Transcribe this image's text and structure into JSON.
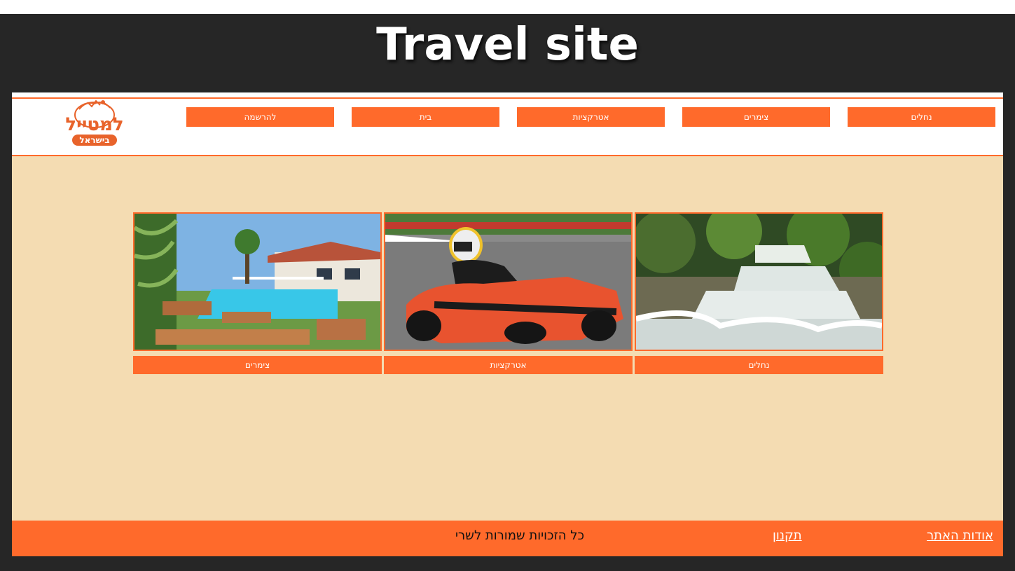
{
  "site": {
    "title": "Travel site"
  },
  "colors": {
    "accent": "#ff6a2b",
    "background": "#f4dcb2",
    "frame": "#262626"
  },
  "logo": {
    "name": "למטייל",
    "subtitle": "בישראל",
    "icon": "globe-logo-icon"
  },
  "nav": {
    "items": [
      {
        "label": "נחלים"
      },
      {
        "label": "צימרים"
      },
      {
        "label": "אטרקציות"
      },
      {
        "label": "בית"
      },
      {
        "label": "להרשמה"
      }
    ]
  },
  "cards": [
    {
      "label": "נחלים",
      "image": "waterfall-stream-photo"
    },
    {
      "label": "אטרקציות",
      "image": "go-kart-racing-photo"
    },
    {
      "label": "צימרים",
      "image": "pool-vacation-cabin-photo"
    }
  ],
  "footer": {
    "about": "אודות האתר",
    "terms": "תקנון",
    "copyright": "כל הזכויות שמורות לשרי"
  }
}
